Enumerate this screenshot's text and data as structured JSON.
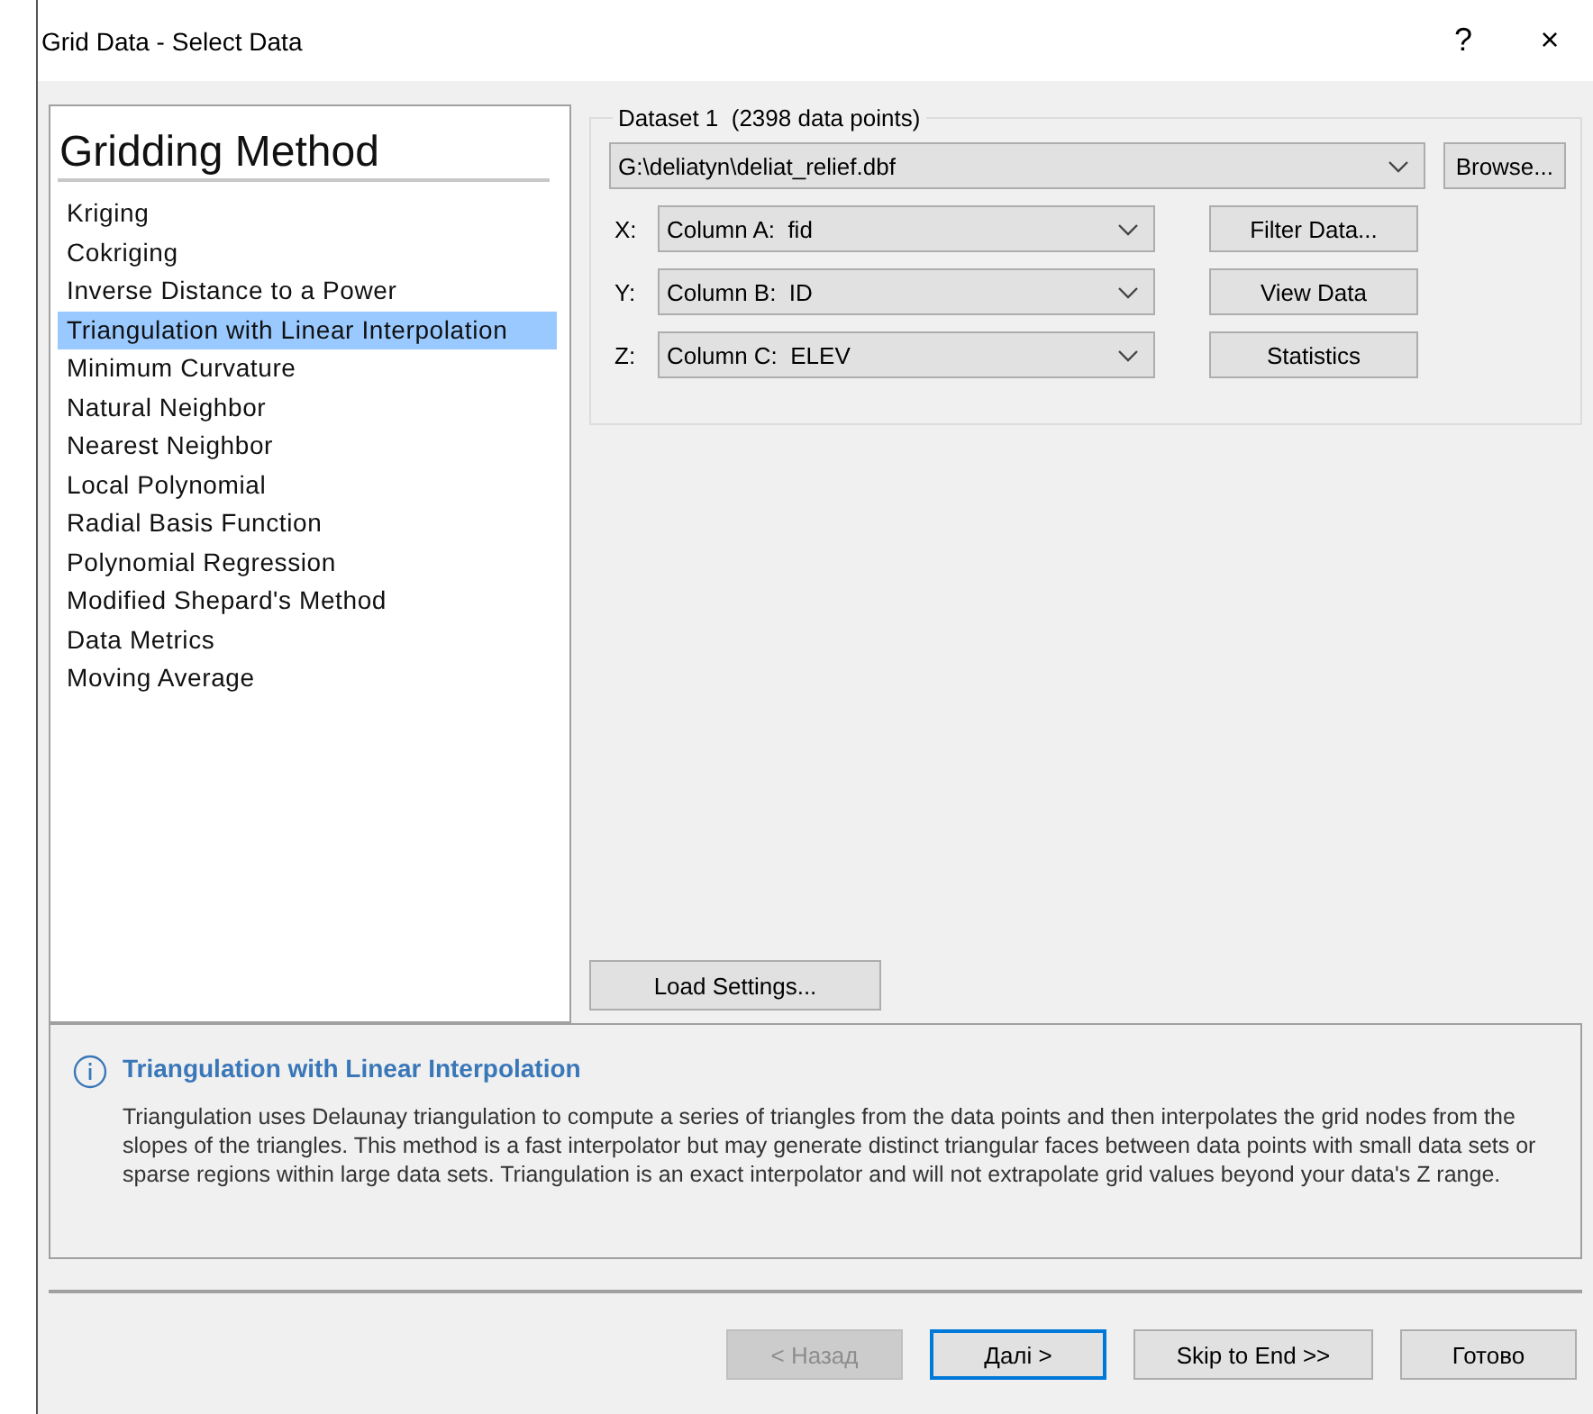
{
  "window": {
    "title": "Grid Data - Select Data",
    "help": "?",
    "close": "×"
  },
  "methods": {
    "title": "Gridding Method",
    "items": [
      {
        "label": "Kriging",
        "selected": false
      },
      {
        "label": "Cokriging",
        "selected": false
      },
      {
        "label": "Inverse Distance to a Power",
        "selected": false
      },
      {
        "label": "Triangulation with Linear Interpolation",
        "selected": true
      },
      {
        "label": "Minimum Curvature",
        "selected": false
      },
      {
        "label": "Natural Neighbor",
        "selected": false
      },
      {
        "label": "Nearest Neighbor",
        "selected": false
      },
      {
        "label": "Local Polynomial",
        "selected": false
      },
      {
        "label": "Radial Basis Function",
        "selected": false
      },
      {
        "label": "Polynomial Regression",
        "selected": false
      },
      {
        "label": "Modified Shepard's Method",
        "selected": false
      },
      {
        "label": "Data Metrics",
        "selected": false
      },
      {
        "label": "Moving Average",
        "selected": false
      }
    ]
  },
  "dataset": {
    "title": "Dataset 1  (2398 data points)",
    "file": "G:\\deliatyn\\deliat_relief.dbf",
    "browse": "Browse...",
    "columns": [
      {
        "axis": "X:",
        "value": "Column A:  fid",
        "button": "Filter Data..."
      },
      {
        "axis": "Y:",
        "value": "Column B:  ID",
        "button": "View Data"
      },
      {
        "axis": "Z:",
        "value": "Column C:  ELEV",
        "button": "Statistics"
      }
    ]
  },
  "load_settings": "Load Settings...",
  "info": {
    "title": "Triangulation with Linear Interpolation",
    "text": "Triangulation uses Delaunay triangulation to compute a series of triangles from the data points and then interpolates the grid nodes from the slopes of the triangles. This method is a fast interpolator but may generate distinct triangular faces between data points with small data sets or sparse regions within large data sets. Triangulation is an exact interpolator and will not extrapolate grid values beyond your data's Z range."
  },
  "buttons": [
    {
      "label": "< Назад",
      "disabled": true,
      "default": false
    },
    {
      "label": "Далі >",
      "disabled": false,
      "default": true
    },
    {
      "label": "Skip to End >>",
      "disabled": false,
      "default": false
    },
    {
      "label": "Готово",
      "disabled": false,
      "default": false
    }
  ]
}
